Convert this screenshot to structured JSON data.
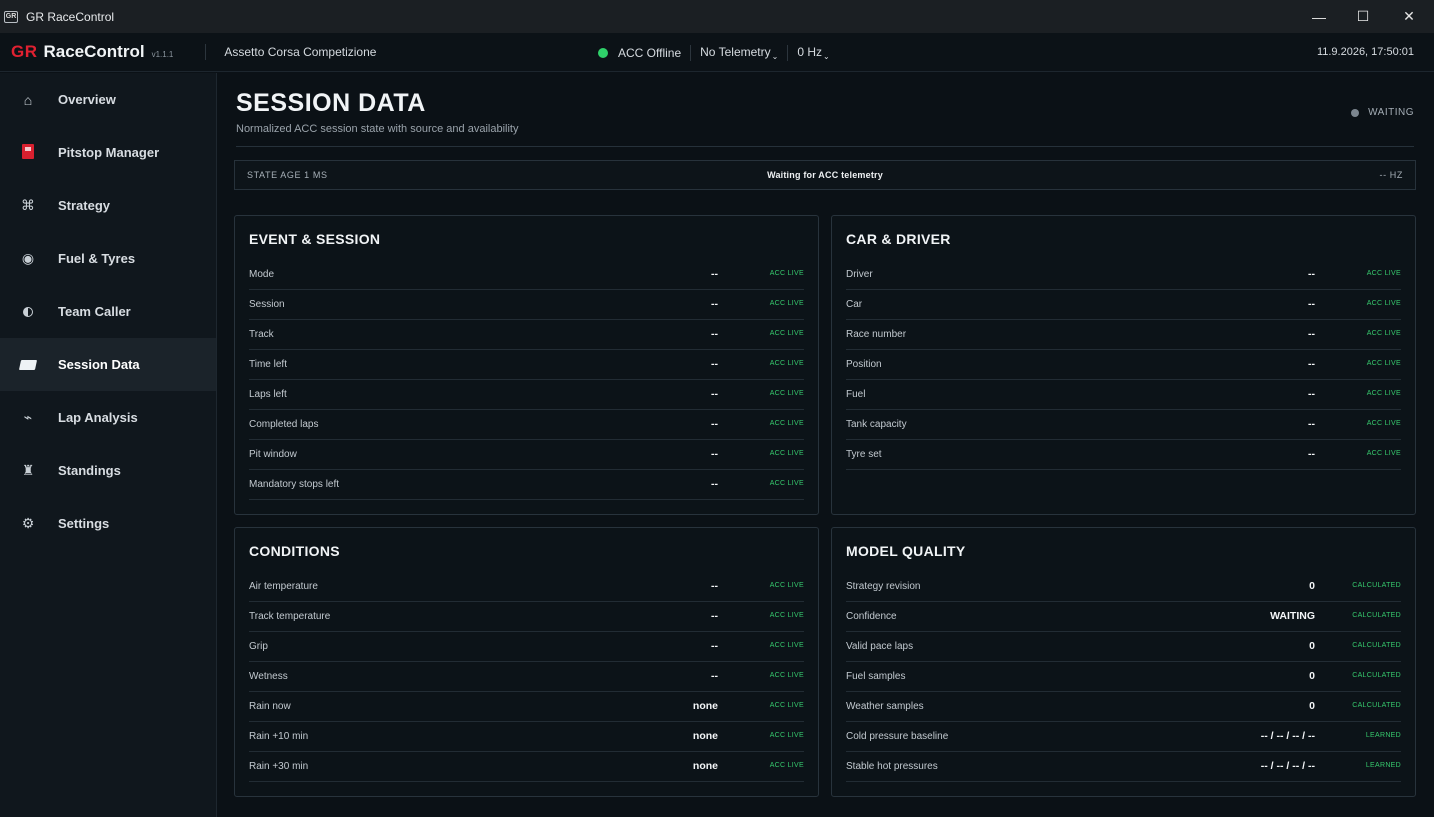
{
  "window": {
    "title": "GR RaceControl",
    "icon_text": "GR",
    "minimize_glyph": "—",
    "maximize_glyph": "☐",
    "close_glyph": "✕"
  },
  "header": {
    "brand_gr": "GR",
    "brand_name": "RaceControl",
    "version": "v1.1.1",
    "game": "Assetto Corsa Competizione",
    "connection": "ACC Offline",
    "connection_color": "#2fd16a",
    "telemetry": "No Telemetry",
    "rate": "0 Hz",
    "dropdown_caret": "⌄",
    "datetime": "11.9.2026, 17:50:01"
  },
  "sidebar": {
    "items": [
      {
        "label": "Overview",
        "icon": "home-icon",
        "glyph": "⌂"
      },
      {
        "label": "Pitstop Manager",
        "icon": "fuel-pump-icon",
        "glyph": ""
      },
      {
        "label": "Strategy",
        "icon": "command-icon",
        "glyph": "⌘"
      },
      {
        "label": "Fuel & Tyres",
        "icon": "tyre-icon",
        "glyph": "◉"
      },
      {
        "label": "Team Caller",
        "icon": "half-moon-icon",
        "glyph": ""
      },
      {
        "label": "Session Data",
        "icon": "card-icon",
        "glyph": "",
        "active": true
      },
      {
        "label": "Lap Analysis",
        "icon": "graph-icon",
        "glyph": "⌁"
      },
      {
        "label": "Standings",
        "icon": "trophy-icon",
        "glyph": "♜"
      },
      {
        "label": "Settings",
        "icon": "gear-icon",
        "glyph": "⚙"
      }
    ]
  },
  "page": {
    "title": "SESSION DATA",
    "subtitle": "Normalized ACC session state with source and availability",
    "status": "WAITING"
  },
  "statebar": {
    "state_age": "STATE AGE 1 MS",
    "message": "Waiting for ACC telemetry",
    "hz": "-- HZ"
  },
  "panels": {
    "event_session": {
      "title": "EVENT & SESSION",
      "rows": [
        {
          "label": "Mode",
          "value": "--",
          "source": "ACC LIVE"
        },
        {
          "label": "Session",
          "value": "--",
          "source": "ACC LIVE"
        },
        {
          "label": "Track",
          "value": "--",
          "source": "ACC LIVE"
        },
        {
          "label": "Time left",
          "value": "--",
          "source": "ACC LIVE"
        },
        {
          "label": "Laps left",
          "value": "--",
          "source": "ACC LIVE"
        },
        {
          "label": "Completed laps",
          "value": "--",
          "source": "ACC LIVE"
        },
        {
          "label": "Pit window",
          "value": "--",
          "source": "ACC LIVE"
        },
        {
          "label": "Mandatory stops left",
          "value": "--",
          "source": "ACC LIVE"
        }
      ]
    },
    "car_driver": {
      "title": "CAR & DRIVER",
      "rows": [
        {
          "label": "Driver",
          "value": "--",
          "source": "ACC LIVE"
        },
        {
          "label": "Car",
          "value": "--",
          "source": "ACC LIVE"
        },
        {
          "label": "Race number",
          "value": "--",
          "source": "ACC LIVE"
        },
        {
          "label": "Position",
          "value": "--",
          "source": "ACC LIVE"
        },
        {
          "label": "Fuel",
          "value": "--",
          "source": "ACC LIVE"
        },
        {
          "label": "Tank capacity",
          "value": "--",
          "source": "ACC LIVE"
        },
        {
          "label": "Tyre set",
          "value": "--",
          "source": "ACC LIVE"
        }
      ]
    },
    "conditions": {
      "title": "CONDITIONS",
      "rows": [
        {
          "label": "Air temperature",
          "value": "--",
          "source": "ACC LIVE"
        },
        {
          "label": "Track temperature",
          "value": "--",
          "source": "ACC LIVE"
        },
        {
          "label": "Grip",
          "value": "--",
          "source": "ACC LIVE"
        },
        {
          "label": "Wetness",
          "value": "--",
          "source": "ACC LIVE"
        },
        {
          "label": "Rain now",
          "value": "none",
          "source": "ACC LIVE"
        },
        {
          "label": "Rain +10 min",
          "value": "none",
          "source": "ACC LIVE"
        },
        {
          "label": "Rain +30 min",
          "value": "none",
          "source": "ACC LIVE"
        }
      ]
    },
    "model_quality": {
      "title": "MODEL QUALITY",
      "rows": [
        {
          "label": "Strategy revision",
          "value": "0",
          "source": "CALCULATED"
        },
        {
          "label": "Confidence",
          "value": "WAITING",
          "source": "CALCULATED"
        },
        {
          "label": "Valid pace laps",
          "value": "0",
          "source": "CALCULATED"
        },
        {
          "label": "Fuel samples",
          "value": "0",
          "source": "CALCULATED"
        },
        {
          "label": "Weather samples",
          "value": "0",
          "source": "CALCULATED"
        },
        {
          "label": "Cold pressure baseline",
          "value": "-- / -- / -- / --",
          "source": "LEARNED"
        },
        {
          "label": "Stable hot pressures",
          "value": "-- / -- / -- / --",
          "source": "LEARNED"
        }
      ]
    }
  },
  "colors": {
    "brand_red": "#e02131",
    "source_green": "#36c96d",
    "status_grey": "#7c868f"
  }
}
